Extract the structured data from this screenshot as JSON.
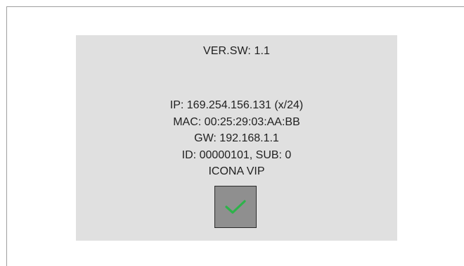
{
  "version": {
    "text": "VER.SW: 1.1"
  },
  "network": {
    "ip": "IP: 169.254.156.131 (x/24)",
    "mac": "MAC: 00:25:29:03:AA:BB",
    "gw": "GW: 192.168.1.1",
    "id": "ID: 00000101, SUB: 0",
    "device": "ICONA VIP"
  },
  "ok_button": {
    "icon": "checkmark-icon",
    "icon_color": "#2db34a",
    "background": "#8f8f8f"
  },
  "colors": {
    "panel": "#e0e0e0",
    "text": "#1f1f1f",
    "frame_border": "#9e9e9e"
  }
}
